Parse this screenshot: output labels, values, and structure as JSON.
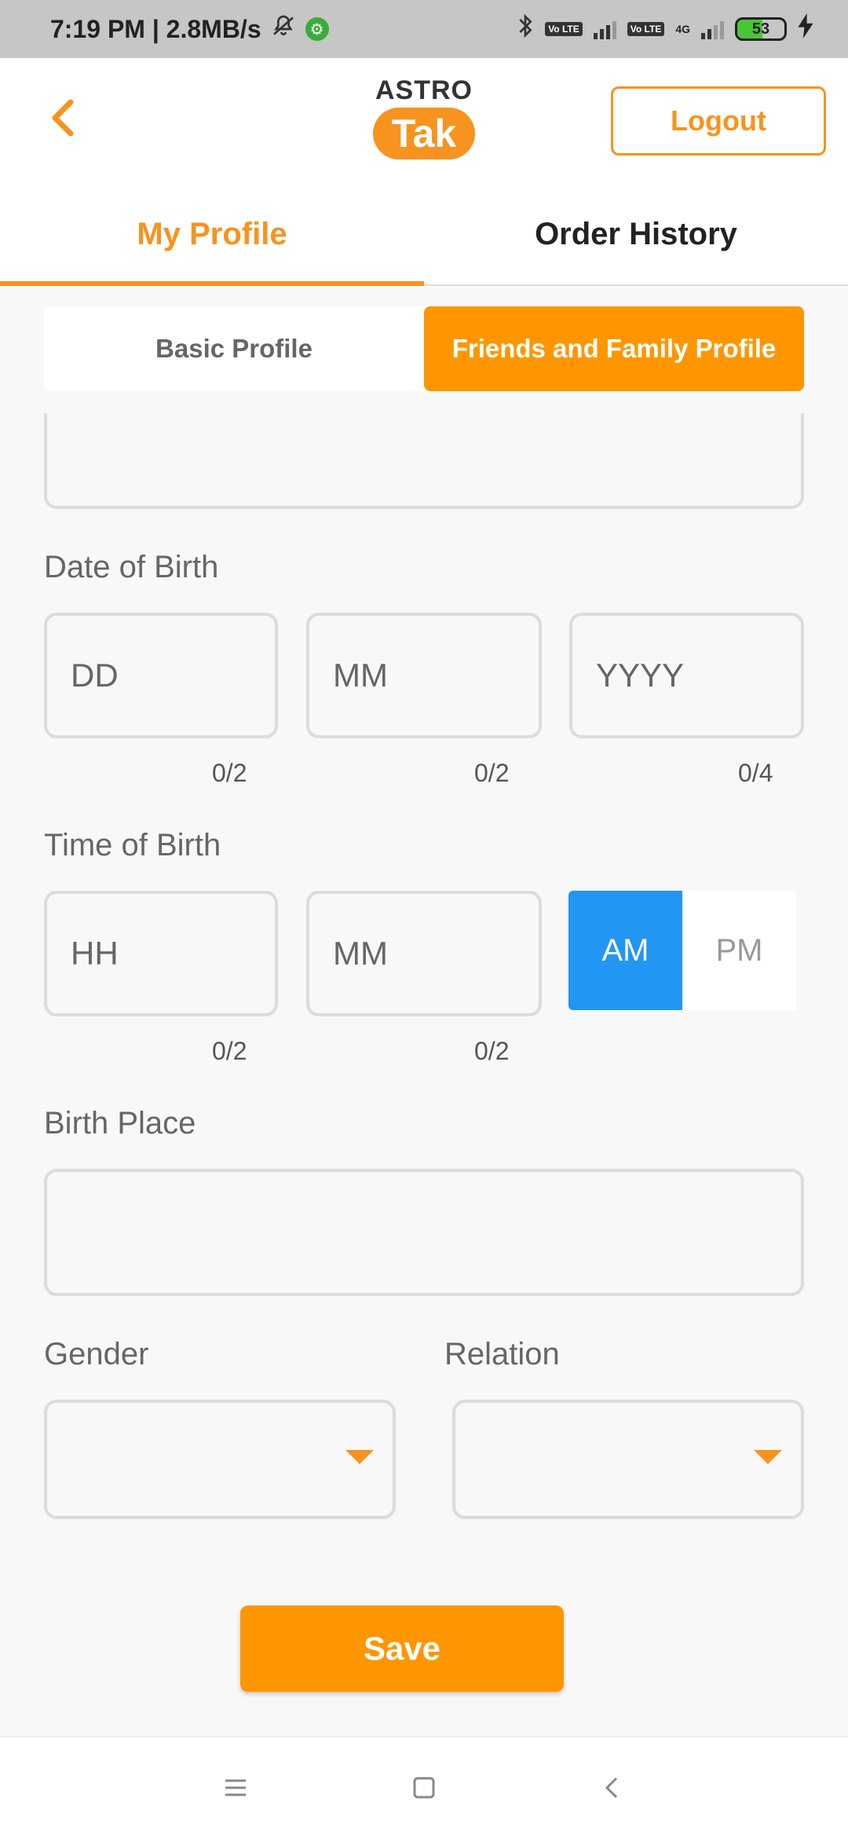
{
  "status_bar": {
    "time_speed": "7:19 PM | 2.8MB/s",
    "volte_1": "Vo LTE",
    "volte_2": "Vo LTE",
    "network": "4G",
    "battery": "53",
    "battery_level": 0.53
  },
  "header": {
    "logo_top": "ASTRO",
    "logo_bottom": "Tak",
    "logout_label": "Logout"
  },
  "main_tabs": [
    {
      "label": "My Profile",
      "active": true
    },
    {
      "label": "Order History",
      "active": false
    }
  ],
  "sub_tabs": [
    {
      "label": "Basic Profile",
      "active": false
    },
    {
      "label": "Friends and Family Profile",
      "active": true
    }
  ],
  "form": {
    "dob": {
      "label": "Date of Birth",
      "day_placeholder": "DD",
      "month_placeholder": "MM",
      "year_placeholder": "YYYY",
      "day_counter": "0/2",
      "month_counter": "0/2",
      "year_counter": "0/4"
    },
    "tob": {
      "label": "Time of Birth",
      "hour_placeholder": "HH",
      "minute_placeholder": "MM",
      "hour_counter": "0/2",
      "minute_counter": "0/2",
      "am_label": "AM",
      "pm_label": "PM",
      "selected": "AM"
    },
    "birth_place": {
      "label": "Birth Place",
      "value": ""
    },
    "gender": {
      "label": "Gender",
      "value": ""
    },
    "relation": {
      "label": "Relation",
      "value": ""
    },
    "save_label": "Save"
  },
  "colors": {
    "accent": "#f7931e",
    "selected_toggle": "#2196f3"
  }
}
